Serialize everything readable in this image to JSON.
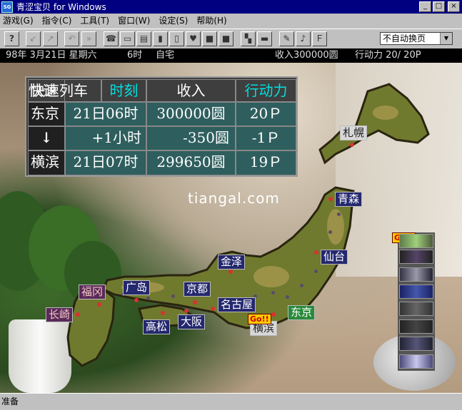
{
  "window": {
    "title": "青涩宝贝 for Windows",
    "icon_text": "SG",
    "minimize": "_",
    "maximize": "□",
    "close": "×"
  },
  "menu": [
    {
      "label": "游戏(G)"
    },
    {
      "label": "指令(C)"
    },
    {
      "label": "工具(T)"
    },
    {
      "label": "窗口(W)"
    },
    {
      "label": "设定(S)"
    },
    {
      "label": "帮助(H)"
    }
  ],
  "toolbar": {
    "help": "?",
    "select_value": "不自动换页"
  },
  "status": {
    "date": "98年 3月21日 星期六",
    "hour": "6时",
    "place": "自宅",
    "income": "收入300000圆",
    "action": "行动力 20/ 20P"
  },
  "info_table": {
    "headers": [
      "快速列车",
      "时刻",
      "收入",
      "行动力"
    ],
    "rows": [
      {
        "place": "东京",
        "time": "21日06时",
        "money": "300000圆",
        "points": "20Ｐ"
      },
      {
        "place": "↓",
        "time": "+1小时",
        "money": "-350圆",
        "points": "-1Ｐ"
      },
      {
        "place": "横滨",
        "time": "21日07时",
        "money": "299650圆",
        "points": "19Ｐ"
      }
    ]
  },
  "cities": [
    {
      "name": "札幌",
      "style": "white"
    },
    {
      "name": "青森"
    },
    {
      "name": "仙台"
    },
    {
      "name": "金泽"
    },
    {
      "name": "广岛"
    },
    {
      "name": "福冈",
      "style": "red"
    },
    {
      "name": "京都"
    },
    {
      "name": "名古屋"
    },
    {
      "name": "长崎",
      "style": "red"
    },
    {
      "name": "高松"
    },
    {
      "name": "大阪"
    },
    {
      "name": "东京",
      "style": "green"
    },
    {
      "name": "横滨",
      "style": "white"
    }
  ],
  "go_badge": "Go!!",
  "watermark": "tiangal.com",
  "statusbar": {
    "text": "准备"
  }
}
